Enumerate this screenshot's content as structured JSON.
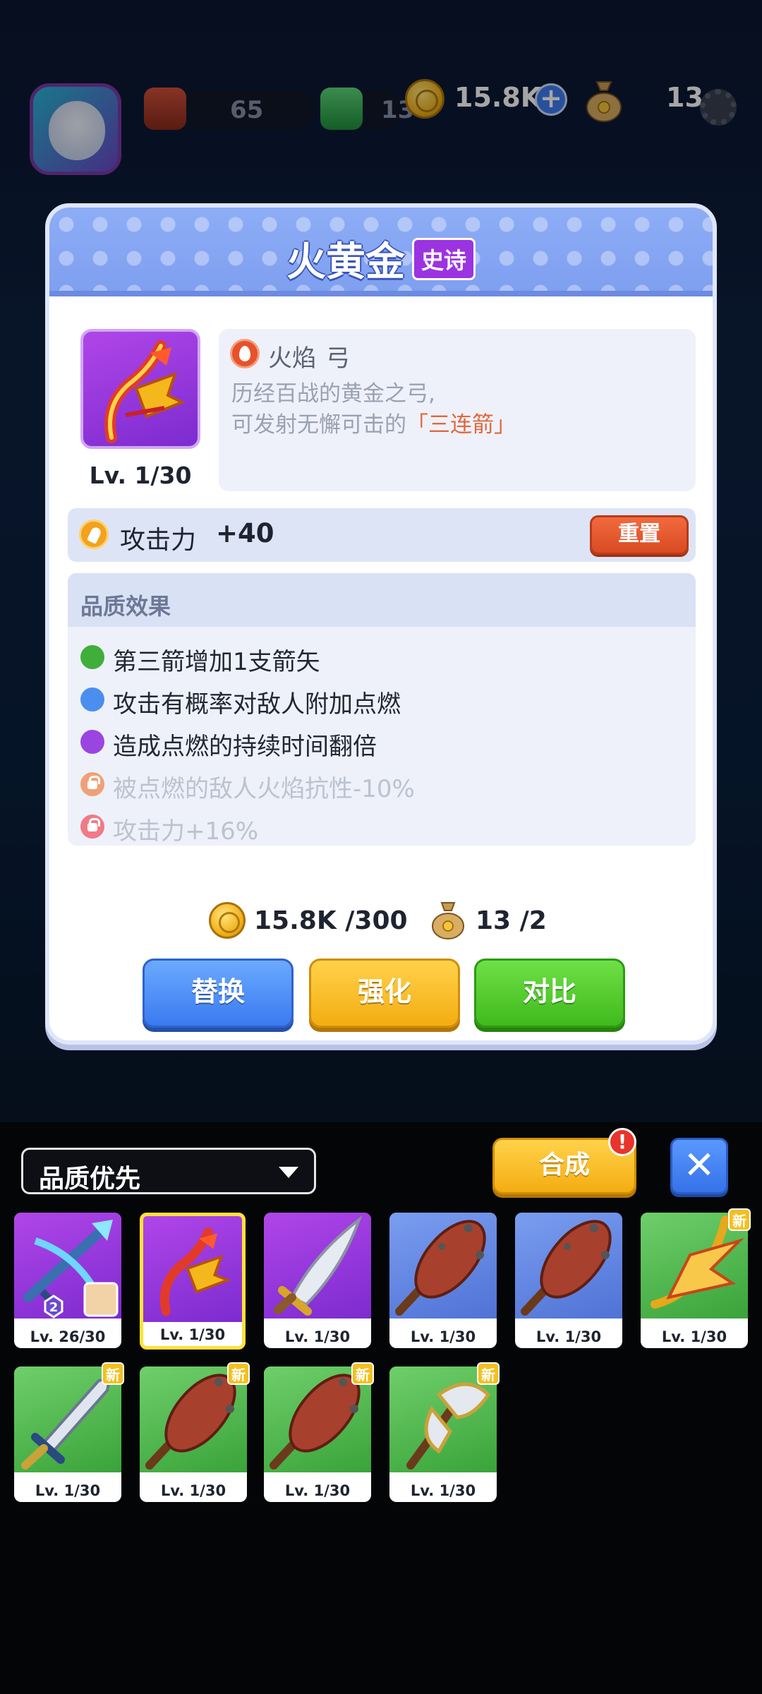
{
  "topbar": {
    "res1_value": "65",
    "res2_value": "13",
    "coins_value": "15.8K",
    "bags_value": "13"
  },
  "panel": {
    "title": "火黄金",
    "rarity": "史诗",
    "level": "Lv. 1/30",
    "element": "火焰",
    "weapon_type": "弓",
    "desc_line1": "历经百战的黄金之弓,",
    "desc_line2_prefix": "可发射无懈可击的",
    "desc_line2_highlight": "「三连箭」",
    "attack_label": "攻击力",
    "attack_value": "+40",
    "reset_label": "重置",
    "quality_title": "品质效果",
    "effects": [
      {
        "text": "第三箭增加1支箭矢",
        "color": "#3fae3a",
        "locked": false
      },
      {
        "text": "攻击有概率对敌人附加点燃",
        "color": "#4a8ef0",
        "locked": false
      },
      {
        "text": "造成点燃的持续时间翻倍",
        "color": "#9a45e0",
        "locked": false
      },
      {
        "text": "被点燃的敌人火焰抗性-10%",
        "color": "#f0a078",
        "locked": true
      },
      {
        "text": "攻击力+16%",
        "color": "#f07a86",
        "locked": true
      }
    ],
    "coin_cost": "15.8K /300",
    "bag_cost": "13 /2",
    "replace_label": "替换",
    "upgrade_label": "强化",
    "compare_label": "对比"
  },
  "inventory": {
    "sort_label": "品质优先",
    "merge_label": "合成",
    "merge_alert": "!",
    "close_label": "✕",
    "new_label": "新",
    "items": [
      {
        "name": "ice-crossbow",
        "level": "Lv. 26/30",
        "bg": "purple",
        "is_new": false,
        "selected": false,
        "badge": "2"
      },
      {
        "name": "fire-gold-bow",
        "level": "Lv. 1/30",
        "bg": "purple",
        "is_new": false,
        "selected": true
      },
      {
        "name": "dagger",
        "level": "Lv. 1/30",
        "bg": "purple",
        "is_new": false,
        "selected": false
      },
      {
        "name": "club",
        "level": "Lv. 1/30",
        "bg": "blue",
        "is_new": false,
        "selected": false
      },
      {
        "name": "club",
        "level": "Lv. 1/30",
        "bg": "blue",
        "is_new": false,
        "selected": false
      },
      {
        "name": "golden-bow",
        "level": "Lv. 1/30",
        "bg": "green",
        "is_new": true,
        "selected": false
      },
      {
        "name": "serrated-sword",
        "level": "Lv. 1/30",
        "bg": "green",
        "is_new": true,
        "selected": false
      },
      {
        "name": "club",
        "level": "Lv. 1/30",
        "bg": "green",
        "is_new": true,
        "selected": false
      },
      {
        "name": "club",
        "level": "Lv. 1/30",
        "bg": "green",
        "is_new": true,
        "selected": false
      },
      {
        "name": "battle-axe",
        "level": "Lv. 1/30",
        "bg": "green",
        "is_new": true,
        "selected": false
      }
    ]
  },
  "colors": {
    "panel_header": "#8eadf6",
    "rarity_epic": "#9b33e0",
    "reset": "#e4582f",
    "replace": "#3a7af0",
    "upgrade": "#f4ad12",
    "compare": "#3fba1c"
  }
}
